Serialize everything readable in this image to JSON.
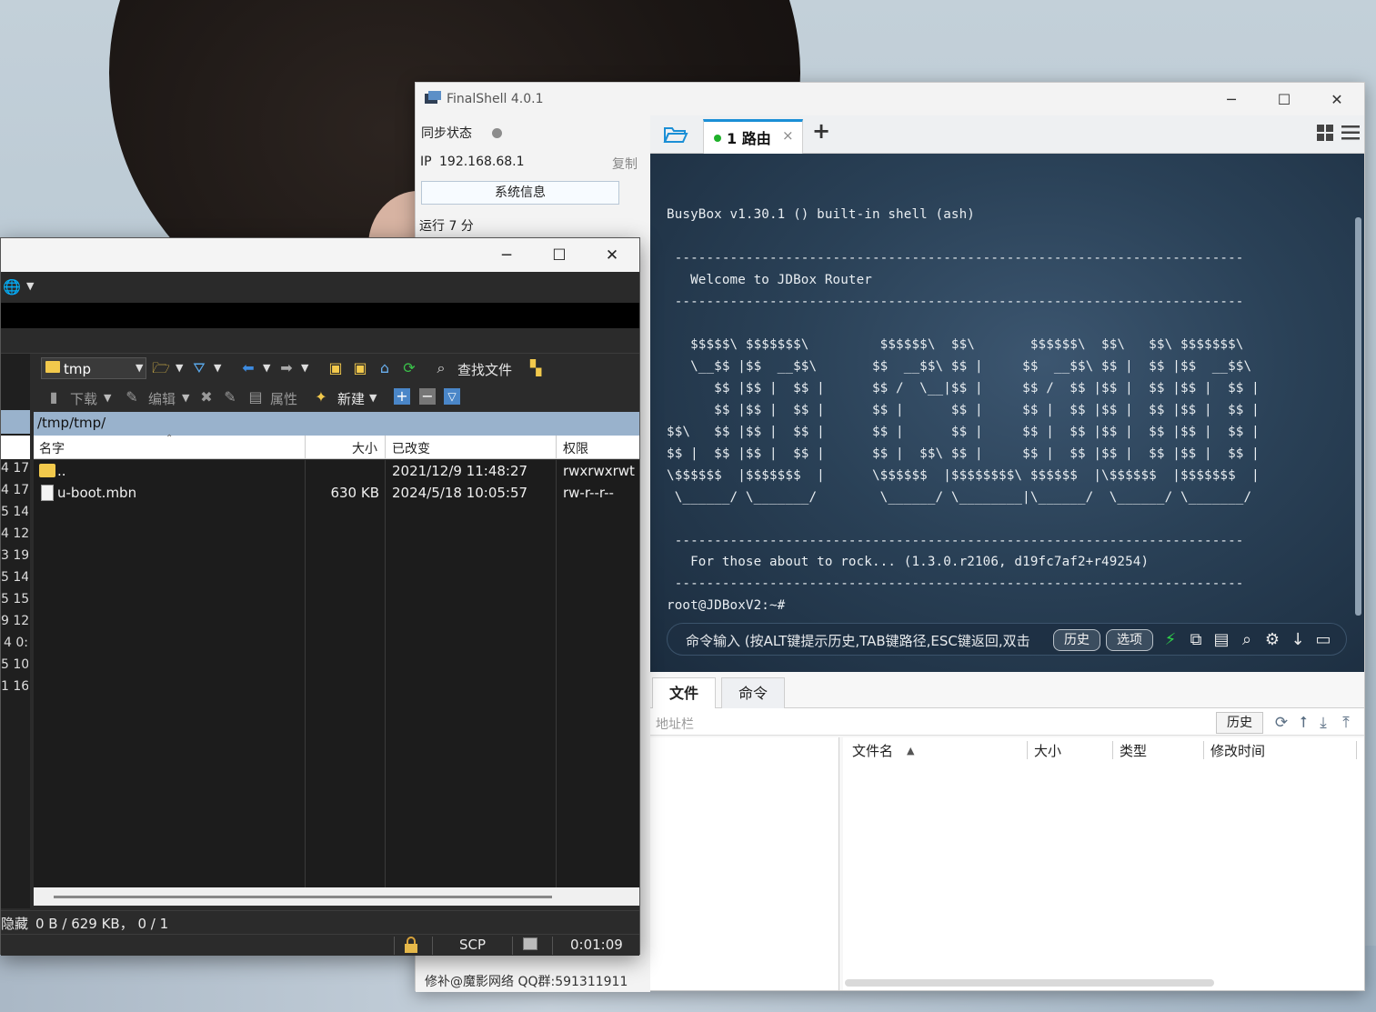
{
  "finalshell": {
    "title": "FinalShell 4.0.1",
    "window_buttons": {
      "minimize": "─",
      "maximize": "☐",
      "close": "✕"
    },
    "sidebar": {
      "sync_label": "同步状态",
      "ip_label": "IP",
      "ip_value": "192.168.68.1",
      "copy_label": "复制",
      "sysinfo_button": "系统信息",
      "uptime": "运行 7 分",
      "footer": "修补@魔影网络 QQ群:591311911"
    },
    "tabs": {
      "active_label": "1 路由",
      "close": "×",
      "add": "+"
    },
    "terminal": {
      "lines": [
        "",
        "BusyBox v1.30.1 () built-in shell (ash)",
        "",
        " ------------------------------------------------------------------------",
        "   Welcome to JDBox Router",
        " ------------------------------------------------------------------------",
        "",
        "   $$$$$\\ $$$$$$$\\         $$$$$$\\  $$\\       $$$$$$\\  $$\\   $$\\ $$$$$$$\\",
        "   \\__$$ |$$  __$$\\       $$  __$$\\ $$ |     $$  __$$\\ $$ |  $$ |$$  __$$\\",
        "      $$ |$$ |  $$ |      $$ /  \\__|$$ |     $$ /  $$ |$$ |  $$ |$$ |  $$ |",
        "      $$ |$$ |  $$ |      $$ |      $$ |     $$ |  $$ |$$ |  $$ |$$ |  $$ |",
        "$$\\   $$ |$$ |  $$ |      $$ |      $$ |     $$ |  $$ |$$ |  $$ |$$ |  $$ |",
        "$$ |  $$ |$$ |  $$ |      $$ |  $$\\ $$ |     $$ |  $$ |$$ |  $$ |$$ |  $$ |",
        "\\$$$$$$  |$$$$$$$  |      \\$$$$$$  |$$$$$$$$\\ $$$$$$  |\\$$$$$$  |$$$$$$$  |",
        " \\______/ \\_______/        \\______/ \\________|\\______/  \\______/ \\_______/",
        "",
        " ------------------------------------------------------------------------",
        "   For those about to rock... (1.3.0.r2106, d19fc7af2+r49254)",
        " ------------------------------------------------------------------------",
        "root@JDBoxV2:~#"
      ],
      "command_placeholder": "命令输入 (按ALT键提示历史,TAB键路径,ESC键返回,双击",
      "history_button": "历史",
      "options_button": "选项"
    },
    "lower": {
      "tab_files": "文件",
      "tab_commands": "命令",
      "address_label": "地址栏",
      "history_button": "历史",
      "columns": {
        "name": "文件名",
        "size": "大小",
        "type": "类型",
        "modified": "修改时间"
      }
    }
  },
  "winscp": {
    "window_buttons": {
      "minimize": "─",
      "maximize": "☐",
      "close": "✕"
    },
    "toolbar": {
      "path_combo": "tmp",
      "find_files": "查找文件",
      "download": "下载",
      "edit": "编辑",
      "properties": "属性",
      "new": "新建"
    },
    "path": "/tmp/tmp/",
    "columns": {
      "name": "名字",
      "size": "大小",
      "modified": "已改变",
      "rights": "权限"
    },
    "files": [
      {
        "name": "..",
        "size": "",
        "modified": "2021/12/9 11:48:27",
        "rights": "rwxrwxrwt"
      },
      {
        "name": "u-boot.mbn",
        "size": "630 KB",
        "modified": "2024/5/18 10:05:57",
        "rights": "rw-r--r--"
      }
    ],
    "left_panel_fragments": [
      "4 17",
      "4 17",
      "5 14",
      "4 12",
      "3 19",
      "5 14",
      "5 15",
      "9 12",
      "4 0:",
      "5 10",
      "1 16"
    ],
    "status": {
      "hidden": "隐藏",
      "selection": "0 B / 629 KB，  0 / 1",
      "protocol": "SCP",
      "elapsed": "0:01:09"
    }
  }
}
